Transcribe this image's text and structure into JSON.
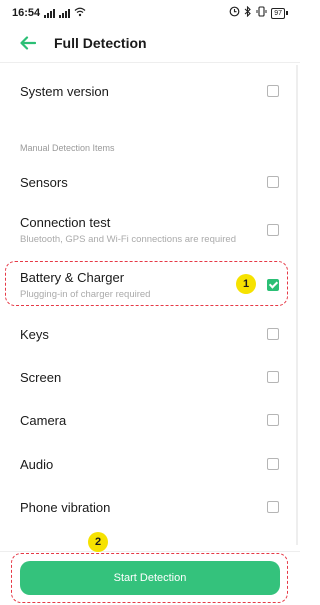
{
  "status_bar": {
    "time": "16:54",
    "battery": "97"
  },
  "header": {
    "title": "Full Detection"
  },
  "items": {
    "system_version": "System version",
    "section_title": "Manual Detection Items",
    "sensors": "Sensors",
    "connection_test": "Connection test",
    "connection_test_note": "Bluetooth, GPS and Wi-Fi connections are required",
    "battery_charger": "Battery & Charger",
    "battery_charger_note": "Plugging-in of charger required",
    "keys": "Keys",
    "screen": "Screen",
    "camera": "Camera",
    "audio": "Audio",
    "phone_vibration": "Phone vibration"
  },
  "badges": {
    "first": "1",
    "second": "2"
  },
  "footer": {
    "start_label": "Start Detection"
  },
  "colors": {
    "accent": "#34c27c",
    "highlight": "#e63946",
    "badge": "#f6e200"
  }
}
